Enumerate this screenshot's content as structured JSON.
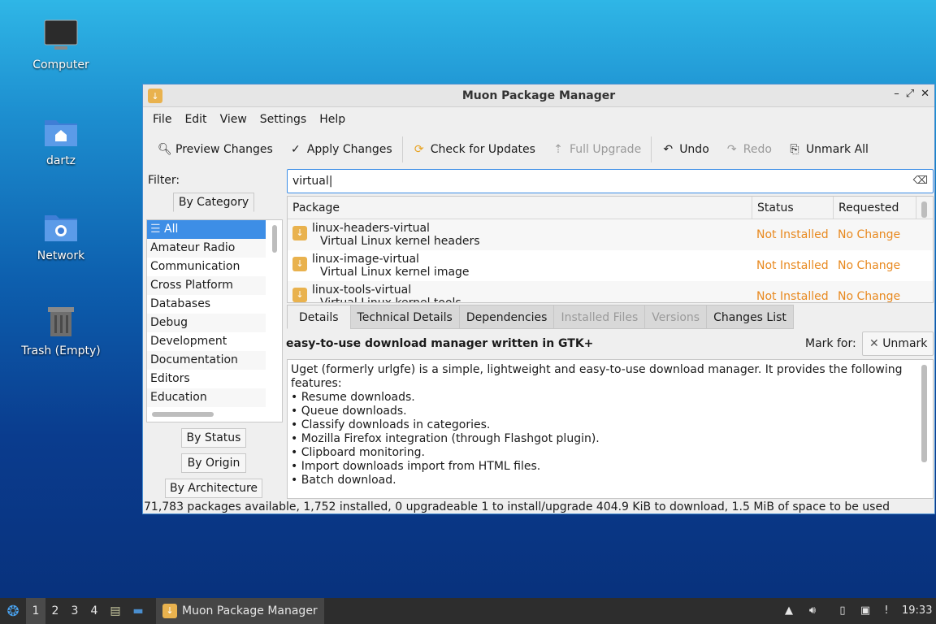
{
  "desktop": {
    "icons": [
      {
        "label": "Computer",
        "icon": "monitor-icon"
      },
      {
        "label": "dartz",
        "icon": "home-folder-icon"
      },
      {
        "label": "Network",
        "icon": "network-folder-icon"
      },
      {
        "label": "Trash (Empty)",
        "icon": "trash-icon"
      }
    ]
  },
  "window": {
    "title": "Muon Package Manager",
    "menu": [
      "File",
      "Edit",
      "View",
      "Settings",
      "Help"
    ],
    "toolbar": {
      "preview": "Preview Changes",
      "apply": "Apply Changes",
      "check": "Check for Updates",
      "full_upgrade": "Full Upgrade",
      "undo": "Undo",
      "redo": "Redo",
      "unmark_all": "Unmark All"
    },
    "filter": {
      "label": "Filter:",
      "by_category": "By Category",
      "by_status": "By Status",
      "by_origin": "By Origin",
      "by_architecture": "By Architecture",
      "categories": [
        "All",
        "Amateur Radio",
        "Communication",
        "Cross Platform",
        "Databases",
        "Debug",
        "Development",
        "Documentation",
        "Editors",
        "Education"
      ]
    },
    "search": {
      "value": "virtual"
    },
    "table": {
      "headers": [
        "Package",
        "Status",
        "Requested"
      ],
      "rows": [
        {
          "name": "linux-headers-virtual",
          "desc": "Virtual Linux kernel headers",
          "status": "Not Installed",
          "requested": "No Change"
        },
        {
          "name": "linux-image-virtual",
          "desc": "Virtual Linux kernel image",
          "status": "Not Installed",
          "requested": "No Change"
        },
        {
          "name": "linux-tools-virtual",
          "desc": "Virtual Linux kernel tools",
          "status": "Not Installed",
          "requested": "No Change"
        }
      ]
    },
    "details": {
      "tabs": [
        "Details",
        "Technical Details",
        "Dependencies",
        "Installed Files",
        "Versions",
        "Changes List"
      ],
      "summary": "easy-to-use download manager written in GTK+",
      "mark_for": "Mark for:",
      "unmark": "Unmark",
      "description_intro": "Uget (formerly urlgfe) is a simple, lightweight and easy-to-use download manager. It provides the following features:",
      "features": [
        "• Resume downloads.",
        "• Queue downloads.",
        "• Classify downloads in categories.",
        "• Mozilla Firefox integration (through Flashgot plugin).",
        "• Clipboard monitoring.",
        "• Import downloads import from HTML files.",
        "• Batch download."
      ]
    },
    "status": "71,783 packages available, 1,752 installed, 0 upgradeable 1 to install/upgrade  404.9 KiB to download, 1.5 MiB of space to be used"
  },
  "taskbar": {
    "workspaces": [
      "1",
      "2",
      "3",
      "4"
    ],
    "task": "Muon Package Manager",
    "clock": "19:33"
  },
  "colors": {
    "accent": "#3d8ee6",
    "status_orange": "#e8891f"
  }
}
